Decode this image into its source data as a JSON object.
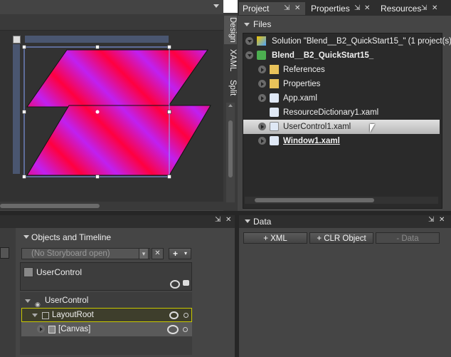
{
  "tabs": {
    "project": "Project",
    "properties": "Properties",
    "resources": "Resources"
  },
  "design_tabs": {
    "design": "Design",
    "xaml": "XAML",
    "split": "Split"
  },
  "files": {
    "header": "Files",
    "items": [
      {
        "label": "Solution \"Blend__B2_QuickStart15_\" (1 project(s))"
      },
      {
        "label": "Blend__B2_QuickStart15_"
      },
      {
        "label": "References"
      },
      {
        "label": "Properties"
      },
      {
        "label": "App.xaml"
      },
      {
        "label": "ResourceDictionary1.xaml"
      },
      {
        "label": "UserControl1.xaml"
      },
      {
        "label": "Window1.xaml"
      }
    ]
  },
  "objects": {
    "header": "Objects and Timeline",
    "storyboard_placeholder": "(No Storyboard open)",
    "scope": "UserControl",
    "tree": [
      {
        "label": "UserControl"
      },
      {
        "label": "LayoutRoot"
      },
      {
        "label": "[Canvas]"
      }
    ]
  },
  "data": {
    "header": "Data",
    "add_xml": "+ XML",
    "add_clr": "+ CLR Object",
    "remove": "- Data"
  },
  "colors": {
    "panel": "#3c3c3c",
    "accent_selection": "#cfcfcf",
    "layoutroot_highlight": "#c8c800"
  }
}
